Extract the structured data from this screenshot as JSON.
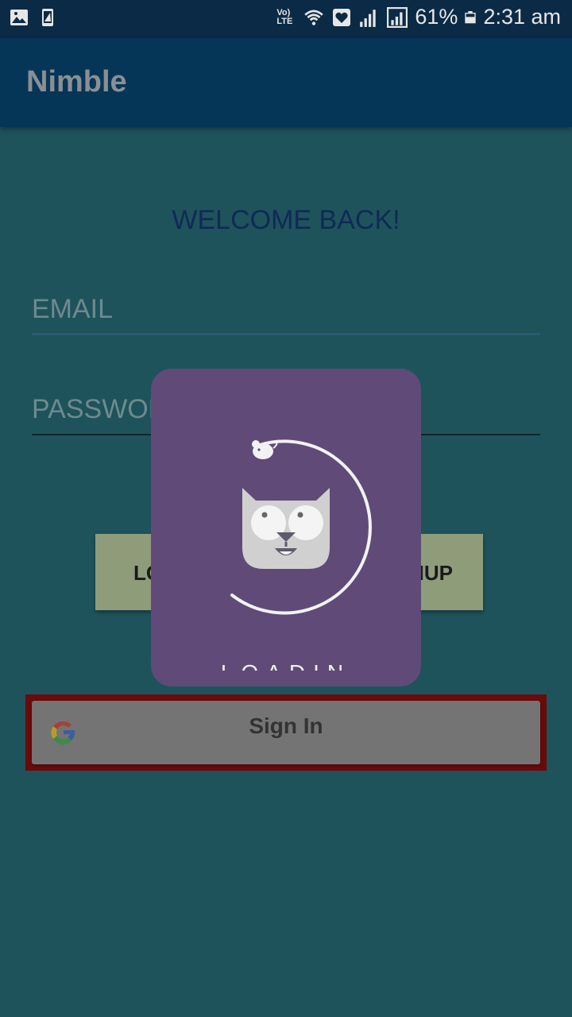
{
  "status_bar": {
    "network_label": "Vo) LTE",
    "battery": "61%",
    "time": "2:31 am"
  },
  "app_bar": {
    "title": "Nimble"
  },
  "login": {
    "welcome": "WELCOME BACK!",
    "email_placeholder": "EMAIL",
    "password_placeholder": "PASSWOR",
    "login_button": "LO",
    "signup_button": "IUP"
  },
  "google": {
    "label": "Sign In"
  },
  "loader": {
    "text": "LOADIN"
  },
  "colors": {
    "background": "#1f535c",
    "app_bar": "#053657",
    "dialog": "#5f4a78",
    "google_border": "#6a0b0b"
  }
}
